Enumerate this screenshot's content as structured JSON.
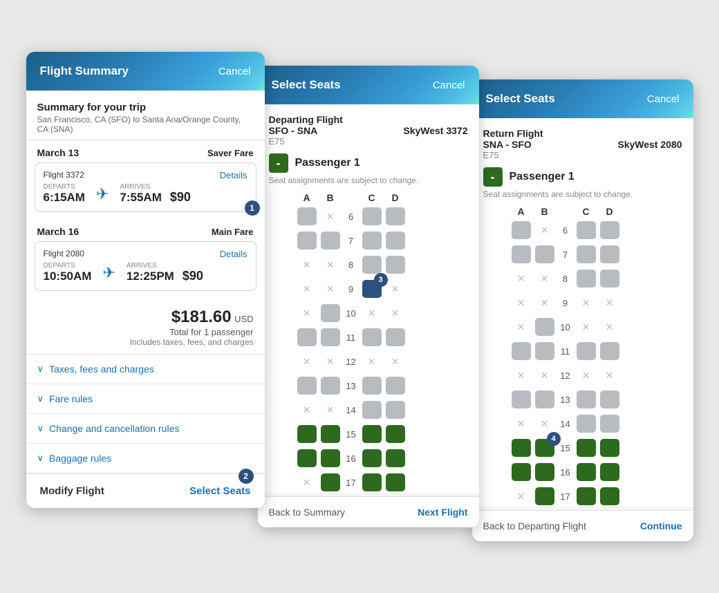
{
  "panel1": {
    "header": {
      "title": "Flight Summary",
      "cancel_label": "Cancel"
    },
    "summary": {
      "title": "Summary for your trip",
      "subtitle": "San Francisco, CA (SFO) to Santa Ana/Orange County, CA (SNA)"
    },
    "flight1": {
      "date": "March 13",
      "fare": "Saver Fare",
      "number": "Flight 3372",
      "departs_label": "DEPARTS",
      "arrives_label": "ARRIVES",
      "departs": "6:15AM",
      "arrives": "7:55AM",
      "price": "$90",
      "details": "Details"
    },
    "flight2": {
      "date": "March 16",
      "fare": "Main Fare",
      "number": "Flight 2080",
      "departs_label": "DEPARTS",
      "arrives_label": "ARRIVES",
      "departs": "10:50AM",
      "arrives": "12:25PM",
      "price": "$90",
      "details": "Details"
    },
    "total": {
      "amount": "$181.60",
      "currency": "USD",
      "label": "Total for 1 passenger",
      "note": "Includes taxes, fees, and charges"
    },
    "accordions": [
      "Taxes, fees and charges",
      "Fare rules",
      "Change and cancellation rules",
      "Baggage rules"
    ],
    "footer": {
      "modify": "Modify Flight",
      "select": "Select Seats"
    },
    "badge1": "1",
    "badge2": "2"
  },
  "panel2": {
    "header": {
      "title": "Select Seats",
      "cancel_label": "Cancel"
    },
    "flight": {
      "type": "Departing Flight",
      "route": "SFO - SNA",
      "flight_num": "SkyWest 3372",
      "aircraft": "E75"
    },
    "passenger": {
      "badge": "-",
      "name": "Passenger 1",
      "note": "Seat assignments are subject to change."
    },
    "columns": [
      "A",
      "B",
      "",
      "C",
      "D"
    ],
    "rows": [
      {
        "num": 6,
        "seats": [
          "avail",
          "taken",
          "avail",
          "avail"
        ]
      },
      {
        "num": 7,
        "seats": [
          "avail",
          "avail",
          "avail",
          "avail"
        ]
      },
      {
        "num": 8,
        "seats": [
          "taken",
          "taken",
          "avail",
          "avail"
        ]
      },
      {
        "num": 9,
        "seats": [
          "taken",
          "taken",
          "selected",
          "taken"
        ]
      },
      {
        "num": 10,
        "seats": [
          "taken",
          "avail",
          "taken",
          "taken"
        ]
      },
      {
        "num": 11,
        "seats": [
          "avail",
          "avail",
          "avail",
          "avail"
        ]
      },
      {
        "num": 12,
        "seats": [
          "taken",
          "taken",
          "taken",
          "taken"
        ]
      },
      {
        "num": 13,
        "seats": [
          "avail",
          "avail",
          "avail",
          "avail"
        ]
      },
      {
        "num": 14,
        "seats": [
          "taken",
          "taken",
          "avail",
          "avail"
        ]
      },
      {
        "num": 15,
        "seats": [
          "green",
          "green",
          "green",
          "green"
        ]
      },
      {
        "num": 16,
        "seats": [
          "green",
          "green",
          "green",
          "green"
        ]
      },
      {
        "num": 17,
        "seats": [
          "taken",
          "green",
          "green",
          "green"
        ]
      }
    ],
    "footer": {
      "back": "Back to Summary",
      "next": "Next Flight"
    },
    "badge3": "3"
  },
  "panel3": {
    "header": {
      "title": "Select Seats",
      "cancel_label": "Cancel"
    },
    "flight": {
      "type": "Return Flight",
      "route": "SNA - SFO",
      "flight_num": "SkyWest 2080",
      "aircraft": "E75"
    },
    "passenger": {
      "badge": "-",
      "name": "Passenger 1",
      "note": "Seat assignments are subject to change."
    },
    "columns": [
      "A",
      "B",
      "",
      "C",
      "D"
    ],
    "rows": [
      {
        "num": 6,
        "seats": [
          "avail",
          "taken",
          "avail",
          "avail"
        ]
      },
      {
        "num": 7,
        "seats": [
          "avail",
          "avail",
          "avail",
          "avail"
        ]
      },
      {
        "num": 8,
        "seats": [
          "taken",
          "taken",
          "avail",
          "avail"
        ]
      },
      {
        "num": 9,
        "seats": [
          "taken",
          "taken",
          "taken",
          "taken"
        ]
      },
      {
        "num": 10,
        "seats": [
          "taken",
          "avail",
          "taken",
          "taken"
        ]
      },
      {
        "num": 11,
        "seats": [
          "avail",
          "avail",
          "avail",
          "avail"
        ]
      },
      {
        "num": 12,
        "seats": [
          "taken",
          "taken",
          "taken",
          "taken"
        ]
      },
      {
        "num": 13,
        "seats": [
          "avail",
          "avail",
          "avail",
          "avail"
        ]
      },
      {
        "num": 14,
        "seats": [
          "taken",
          "taken",
          "avail",
          "avail"
        ]
      },
      {
        "num": 15,
        "seats": [
          "green",
          "green",
          "green",
          "green"
        ]
      },
      {
        "num": 16,
        "seats": [
          "green",
          "green",
          "green",
          "green"
        ]
      },
      {
        "num": 17,
        "seats": [
          "taken",
          "green",
          "green",
          "green"
        ]
      }
    ],
    "footer": {
      "back": "Back to Departing Flight",
      "next": "Continue"
    },
    "badge4": "4"
  }
}
